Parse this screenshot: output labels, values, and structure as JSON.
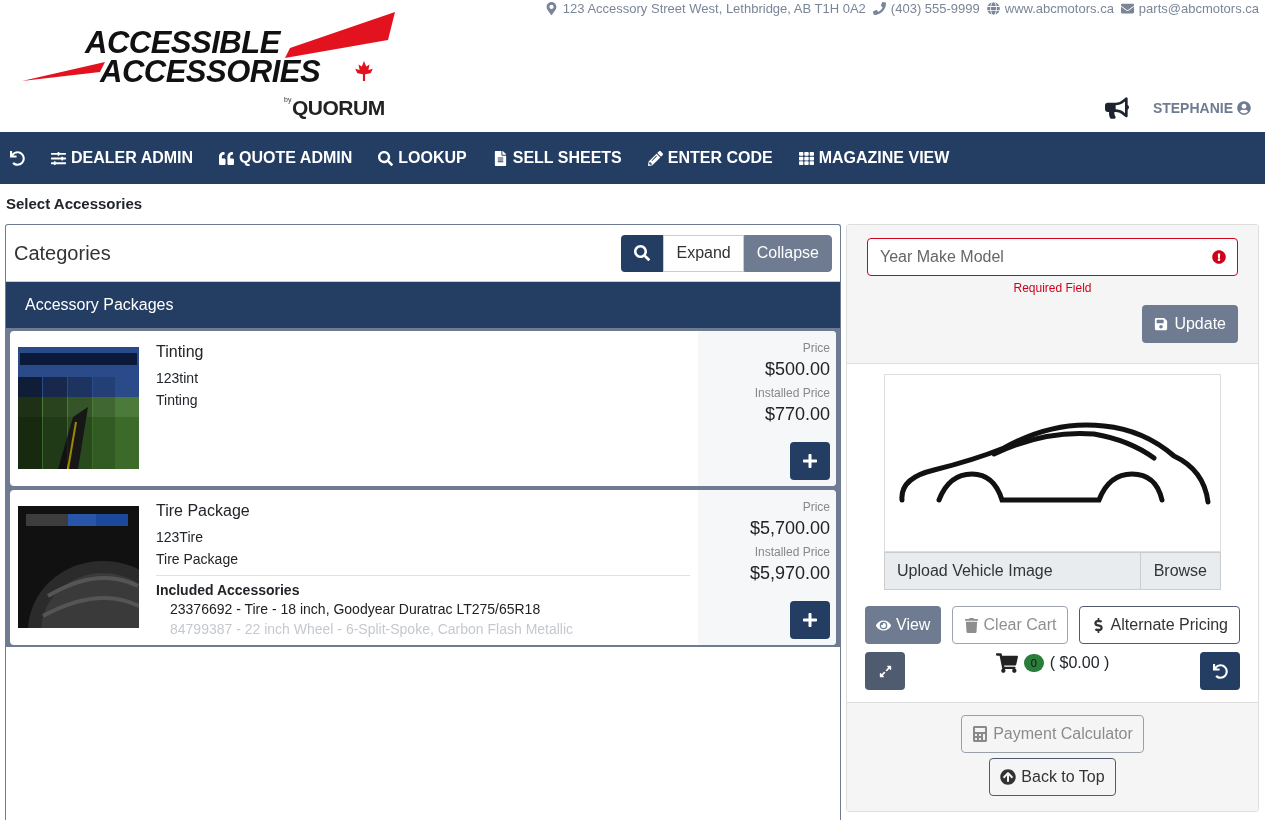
{
  "logo": {
    "line_1": "ACCESSIBLE",
    "line_2": "ACCESSORIES",
    "by": "by",
    "brand": "QUORUM"
  },
  "contact": {
    "address": "123 Accessory Street West, Lethbridge, AB T1H 0A2",
    "phone": "(403) 555-9999",
    "website": "www.abcmotors.ca",
    "email": "parts@abcmotors.ca"
  },
  "user": {
    "name": "STEPHANIE"
  },
  "nav": [
    {
      "label": "DEALER ADMIN"
    },
    {
      "label": "QUOTE ADMIN"
    },
    {
      "label": "LOOKUP"
    },
    {
      "label": "SELL SHEETS"
    },
    {
      "label": "ENTER CODE"
    },
    {
      "label": "MAGAZINE VIEW"
    }
  ],
  "page_title": "Select Accessories",
  "categories": {
    "title": "Categories",
    "expand": {
      "label": "Expand",
      "selected": false
    },
    "collapse": {
      "label": "Collapse",
      "selected": true
    },
    "section": "Accessory Packages",
    "items": [
      {
        "kind": "tint",
        "name": "Tinting",
        "code": "123tint",
        "category": "Tinting",
        "price_label": "Price",
        "price": "$500.00",
        "installed_label": "Installed Price",
        "installed_price": "$770.00"
      },
      {
        "kind": "tire",
        "name": "Tire Package",
        "code": "123Tire",
        "category": "Tire Package",
        "price_label": "Price",
        "price": "$5,700.00",
        "installed_label": "Installed Price",
        "installed_price": "$5,970.00",
        "included_title": "Included Accessories",
        "included": [
          "23376692 - Tire - 18 inch, Goodyear Duratrac LT275/65R18",
          "84799387 - 22 inch Wheel - 6-Split-Spoke, Carbon Flash Metallic"
        ]
      }
    ]
  },
  "vehicle": {
    "placeholder": "Year Make Model",
    "error": "Required Field",
    "update": "Update",
    "upload_placeholder": "Upload Vehicle Image",
    "browse": "Browse"
  },
  "cart_actions": [
    {
      "label": "View",
      "disabled": false
    },
    {
      "label": "Clear Cart",
      "disabled": true
    },
    {
      "label": "Alternate Pricing",
      "disabled": false
    }
  ],
  "cart": {
    "count": "0",
    "total": "( $0.00 )"
  },
  "footer_buttons": [
    {
      "label": "Payment Calculator",
      "disabled": true
    },
    {
      "label": "Back to Top",
      "disabled": false
    }
  ]
}
